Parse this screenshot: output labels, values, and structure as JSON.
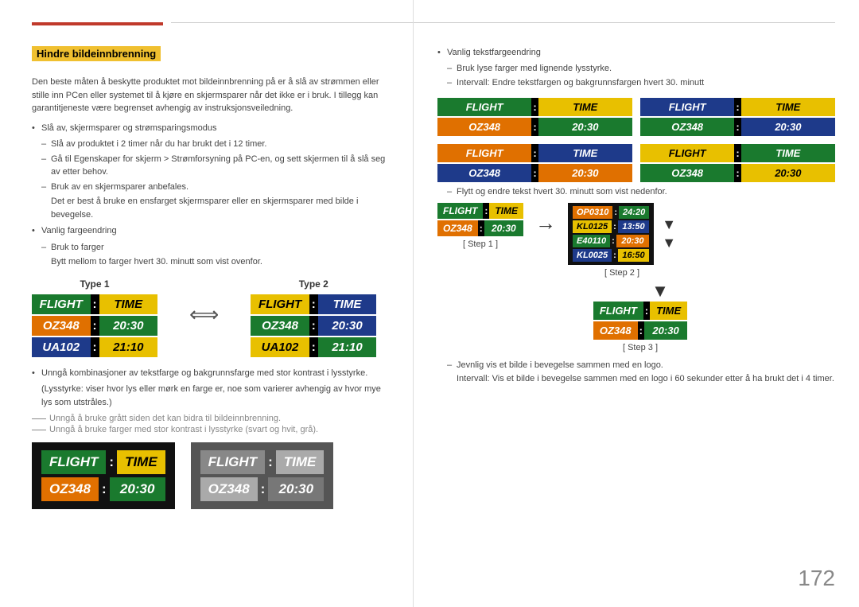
{
  "page": {
    "number": "172"
  },
  "left": {
    "section_title": "Hindre bildeinnbrenning",
    "intro_text": "Den beste måten å beskytte produktet mot bildeinnbrenning på er å slå av strømmen eller stille inn PCen eller systemet til å kjøre en skjermsparer når det ikke er i bruk. I tillegg kan garantitjeneste være begrenset avhengig av instruksjonsveiledning.",
    "bullets": [
      "Slå av, skjermsparer og strømsparingsmodus",
      "Vanlig fargeendring"
    ],
    "dash_items_1": [
      "Slå av produktet i 2 timer når du har brukt det i 12 timer.",
      "Gå til Egenskaper for skjerm > Strømforsyning på PC-en, og sett skjermen til å slå seg av etter behov.",
      "Bruk av en skjermsparer anbefales."
    ],
    "sub_text_1": "Det er best å bruke en ensfarget skjermsparer eller en skjermsparer med bilde i bevegelse.",
    "dash_items_2": [
      "Bruk to farger"
    ],
    "sub_text_2": "Bytt mellom to farger hvert 30. minutt som vist ovenfor.",
    "type1_label": "Type 1",
    "type2_label": "Type 2",
    "boards": {
      "type1": {
        "flight_label": "FLIGHT",
        "time_label": "TIME",
        "row1_code": "OZ348",
        "row1_time": "20:30",
        "row2_code": "UA102",
        "row2_time": "21:10"
      },
      "type2": {
        "flight_label": "FLIGHT",
        "time_label": "TIME",
        "row1_code": "OZ348",
        "row1_time": "20:30",
        "row2_code": "UA102",
        "row2_time": "21:10"
      }
    },
    "avoid_text": "Unngå kombinasjoner av tekstfarge og bakgrunnsfarge med stor kontrast i lysstyrke.",
    "avoid_sub": "(Lysstyrke: viser hvor lys eller mørk en farge er, noe som varierer avhengig av hvor mye lys som utstråles.)",
    "gray_note_1": "Unngå å bruke grått siden det kan bidra til bildeinnbrenning.",
    "gray_note_2": "Unngå å bruke farger med stor kontrast i lysstyrke (svart og hvit, grå).",
    "bottom_board_left": {
      "flight": "FLIGHT",
      "colon": ":",
      "time": "TIME",
      "code": "OZ348",
      "colon2": ":",
      "clock": "20:30"
    },
    "bottom_board_right": {
      "flight": "FLIGHT",
      "colon": ":",
      "time": "TIME",
      "code": "OZ348",
      "colon2": ":",
      "clock": "20:30"
    }
  },
  "right": {
    "bullet_text": "Vanlig tekstfargeendring",
    "dash_text_1": "Bruk lyse farger med lignende lysstyrke.",
    "dash_text_2": "Intervall: Endre tekstfargen og bakgrunnsfargen hvert 30. minutt",
    "boards_grid": [
      {
        "flight": "FLIGHT",
        "colon": ":",
        "time": "TIME",
        "code": "OZ348",
        "time_val": "20:30",
        "header_color": "green_yellow",
        "row_color": "orange_green"
      },
      {
        "flight": "FLIGHT",
        "colon": ":",
        "time": "TIME",
        "code": "OZ348",
        "time_val": "20:30",
        "header_color": "blue_yellow",
        "row_color": "green_blue"
      },
      {
        "flight": "FLIGHT",
        "colon": ":",
        "time": "TIME",
        "code": "OZ348",
        "time_val": "20:30",
        "header_color": "green_blue",
        "row_color": "blue_green"
      },
      {
        "flight": "FLIGHT",
        "colon": ":",
        "time": "TIME",
        "code": "OZ348",
        "time_val": "20:30",
        "header_color": "orange_blue",
        "row_color": "blue_orange"
      }
    ],
    "shift_note": "Flytt og endre tekst hvert 30. minutt som vist nedenfor.",
    "step_labels": [
      "[ Step 1 ]",
      "[ Step 2 ]",
      "[ Step 3 ]"
    ],
    "step1_board": {
      "code": "OZ348",
      "time": "20:30"
    },
    "step2_rows": [
      {
        "code": "OP0310",
        "time": "24:20"
      },
      {
        "code": "KL0125",
        "time": "13:50"
      },
      {
        "code": "E40110",
        "time": "20:30"
      },
      {
        "code": "KL0025",
        "time": "16:50"
      }
    ],
    "step3_board": {
      "flight": "FLIGHT",
      "colon": ":",
      "time": "TIME",
      "code": "OZ348",
      "time_val": "20:30"
    },
    "bottom_notes": [
      "Jevnlig vis et bilde i bevegelse sammen med en logo.",
      "Intervall: Vis et bilde i bevegelse sammen med en logo i 60 sekunder etter å ha brukt det i 4 timer."
    ]
  }
}
